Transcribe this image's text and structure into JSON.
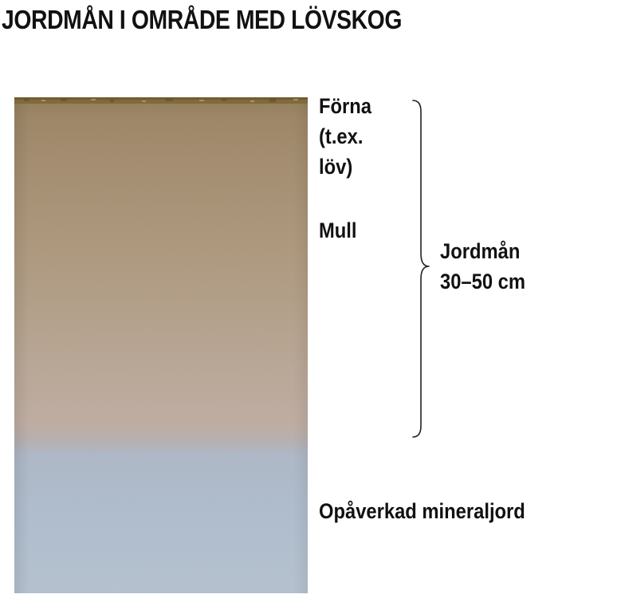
{
  "title": "JORDMÅN I OMRÅDE MED LÖVSKOG",
  "labels": {
    "forna": [
      "Förna",
      "(t.ex.",
      "löv)"
    ],
    "mull": "Mull",
    "jordman": [
      "Jordmån",
      "30–50 cm"
    ],
    "mineral": "Opåverkad mineraljord"
  },
  "colors": {
    "litter": "#8a7044",
    "humus_top": "#a58e6e",
    "humus_bottom": "#c2ad9c",
    "mineral": "#aebdce",
    "text": "#111111"
  }
}
